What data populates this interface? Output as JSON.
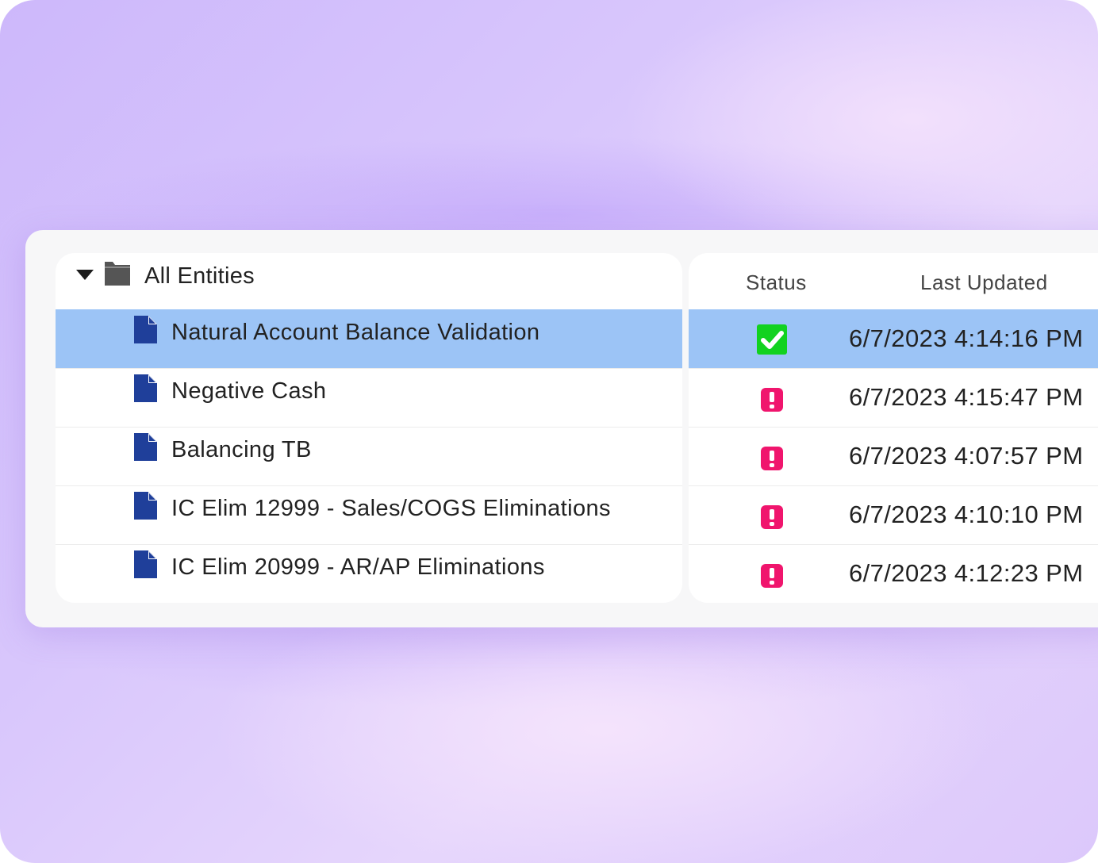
{
  "tree": {
    "root_label": "All Entities",
    "items": [
      {
        "label": "Natural Account Balance Validation",
        "selected": true
      },
      {
        "label": "Negative Cash",
        "selected": false
      },
      {
        "label": "Balancing TB",
        "selected": false
      },
      {
        "label": "IC Elim 12999 - Sales/COGS Eliminations",
        "selected": false
      },
      {
        "label": "IC Elim 20999 - AR/AP Eliminations",
        "selected": false
      }
    ]
  },
  "grid": {
    "columns": {
      "status": "Status",
      "last_updated": "Last Updated"
    },
    "rows": [
      {
        "status": "success",
        "status_icon": "check-icon",
        "last_updated": "6/7/2023 4:14:16 PM"
      },
      {
        "status": "error",
        "status_icon": "exclamation-icon",
        "last_updated": "6/7/2023 4:15:47 PM"
      },
      {
        "status": "error",
        "status_icon": "exclamation-icon",
        "last_updated": "6/7/2023 4:07:57 PM"
      },
      {
        "status": "error",
        "status_icon": "exclamation-icon",
        "last_updated": "6/7/2023 4:10:10 PM"
      },
      {
        "status": "error",
        "status_icon": "exclamation-icon",
        "last_updated": "6/7/2023 4:12:23 PM"
      }
    ]
  },
  "colors": {
    "selected_row": "#9cc4f6",
    "success": "#12d21f",
    "error": "#f0156d",
    "doc_icon": "#1f3f9a",
    "folder_icon": "#555555"
  }
}
